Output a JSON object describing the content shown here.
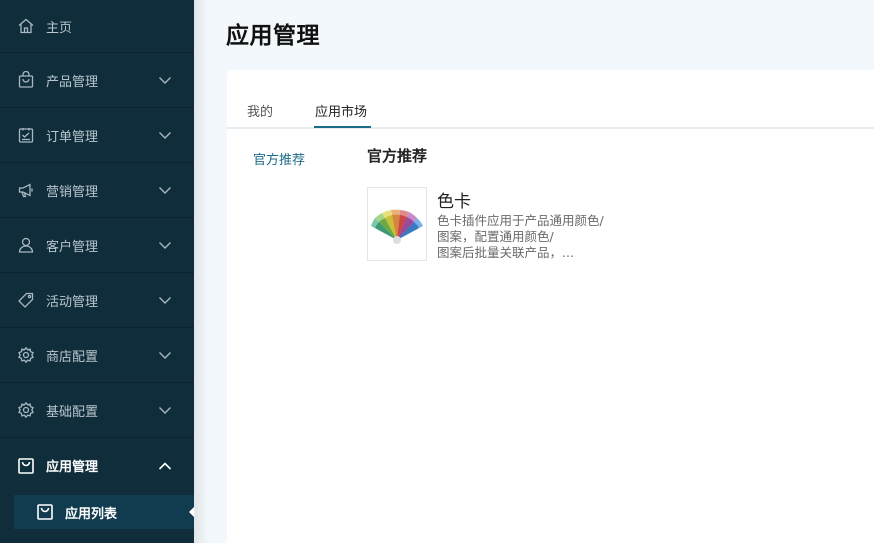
{
  "sidebar": {
    "items": [
      {
        "label": "主页",
        "icon": "home-icon"
      },
      {
        "label": "产品管理",
        "icon": "bag-icon"
      },
      {
        "label": "订单管理",
        "icon": "clipboard-icon"
      },
      {
        "label": "营销管理",
        "icon": "megaphone-icon"
      },
      {
        "label": "客户管理",
        "icon": "user-icon"
      },
      {
        "label": "活动管理",
        "icon": "tag-icon"
      },
      {
        "label": "商店配置",
        "icon": "gear-icon"
      },
      {
        "label": "基础配置",
        "icon": "gear-icon"
      },
      {
        "label": "应用管理",
        "icon": "shopping-bag-icon"
      }
    ],
    "sub_item": {
      "label": "应用列表",
      "icon": "shopping-bag-icon"
    }
  },
  "header": {
    "title": "应用管理"
  },
  "tabs": [
    {
      "label": "我的"
    },
    {
      "label": "应用市场"
    }
  ],
  "categories": [
    {
      "label": "官方推荐"
    }
  ],
  "section": {
    "title": "官方推荐"
  },
  "app": {
    "name": "色卡",
    "description_lines": [
      "色卡插件应用于产品通用颜色/",
      "图案，配置通用颜色/",
      "图案后批量关联产品，..."
    ]
  },
  "colors": {
    "sidebar_bg": "#0f2d3b",
    "accent": "#1a6b86",
    "active_sub_bg": "#113b4e"
  }
}
